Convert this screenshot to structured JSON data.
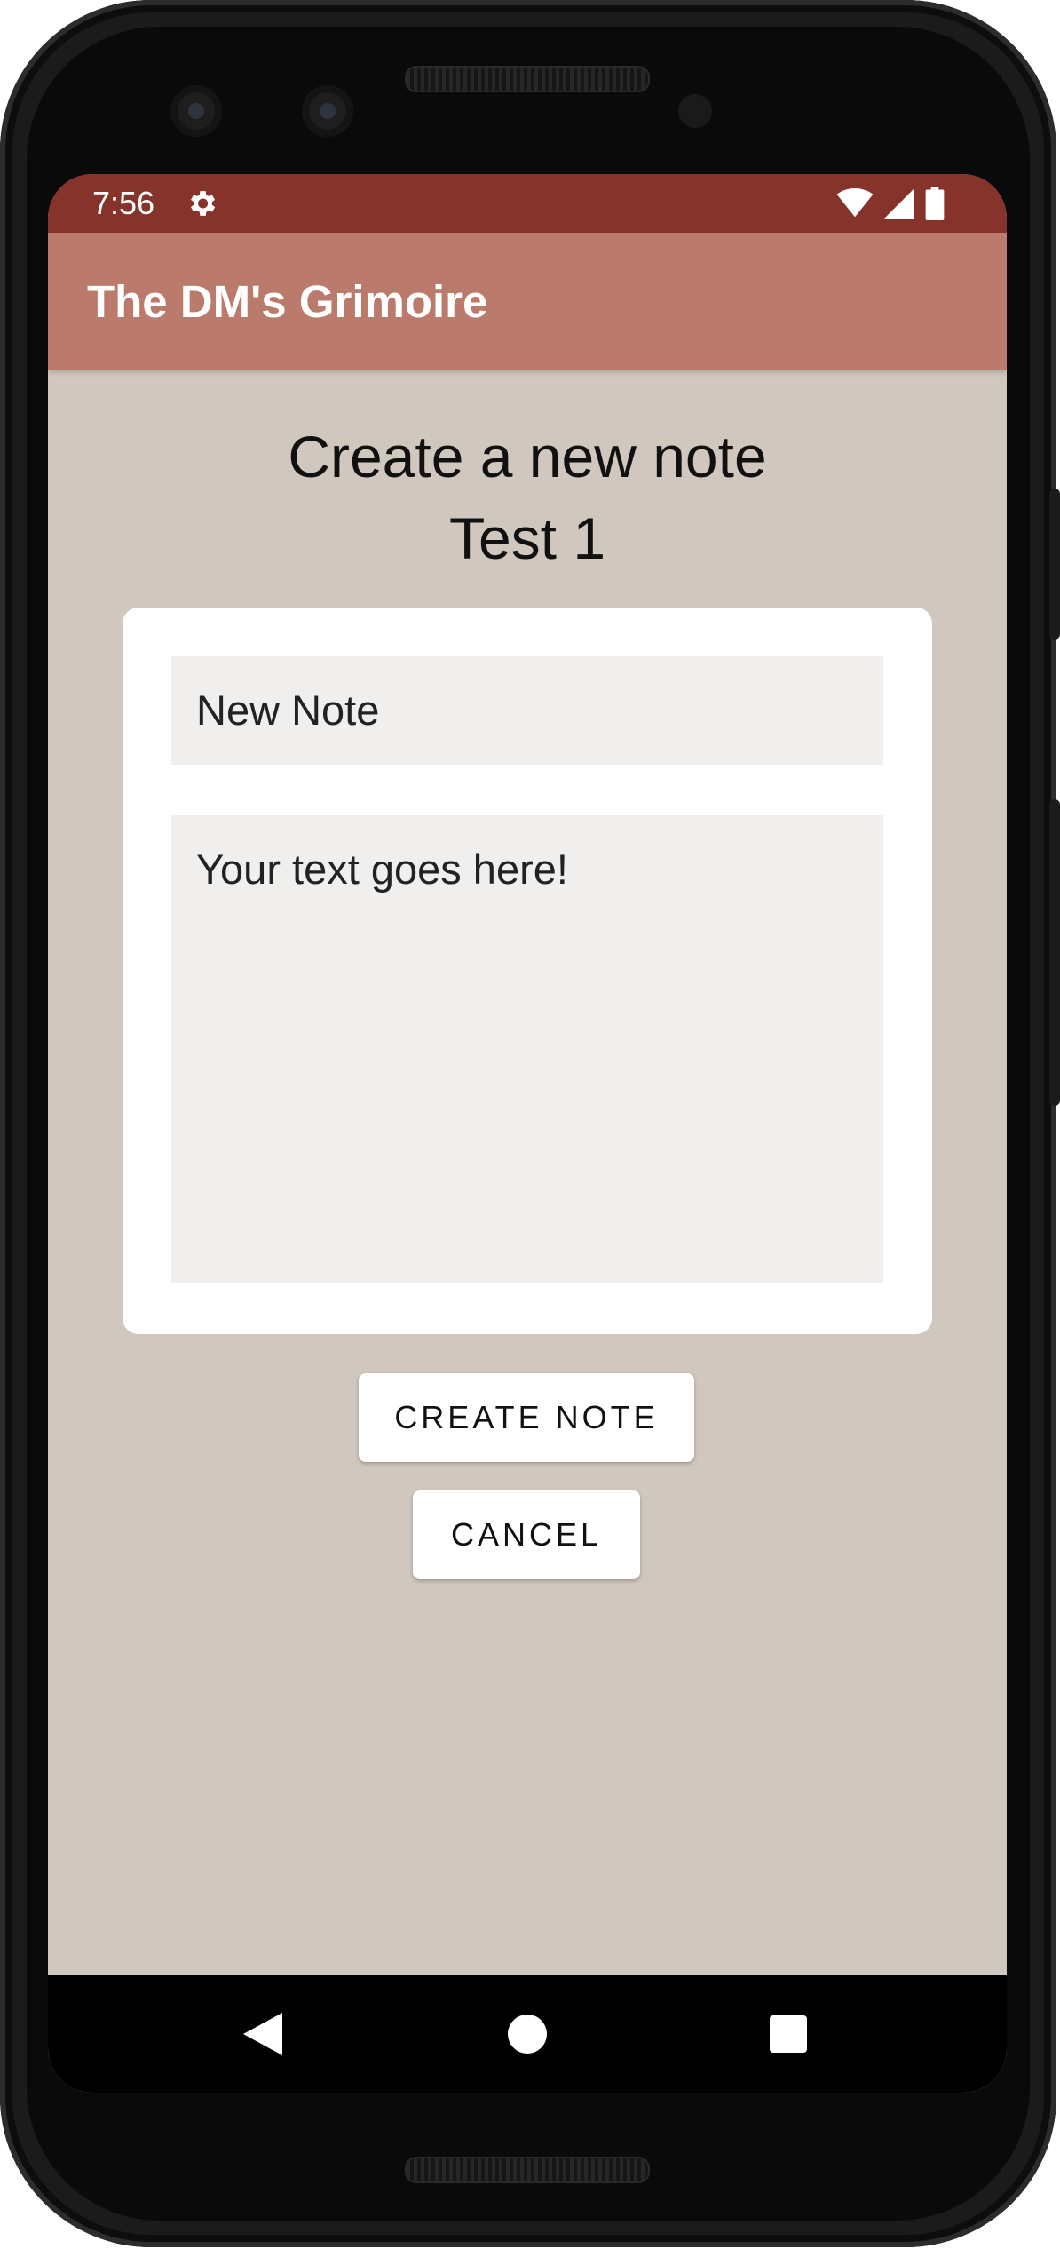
{
  "status_bar": {
    "time": "7:56",
    "settings_icon": "gear-icon",
    "wifi_icon": "wifi-icon",
    "signal_icon": "signal-icon",
    "battery_icon": "battery-icon",
    "color": "#86332b"
  },
  "app_bar": {
    "title": "The DM's Grimoire",
    "color": "#ba7b6c"
  },
  "main": {
    "heading": "Create a new note",
    "subheading": "Test 1",
    "background": "#d0c8be",
    "note_form": {
      "title_value": "New Note",
      "body_value": "Your text goes here!"
    },
    "create_button_label": "CREATE NOTE",
    "cancel_button_label": "CANCEL"
  },
  "nav_bar": {
    "back_icon": "back-triangle-icon",
    "home_icon": "home-circle-icon",
    "recents_icon": "recents-square-icon"
  }
}
